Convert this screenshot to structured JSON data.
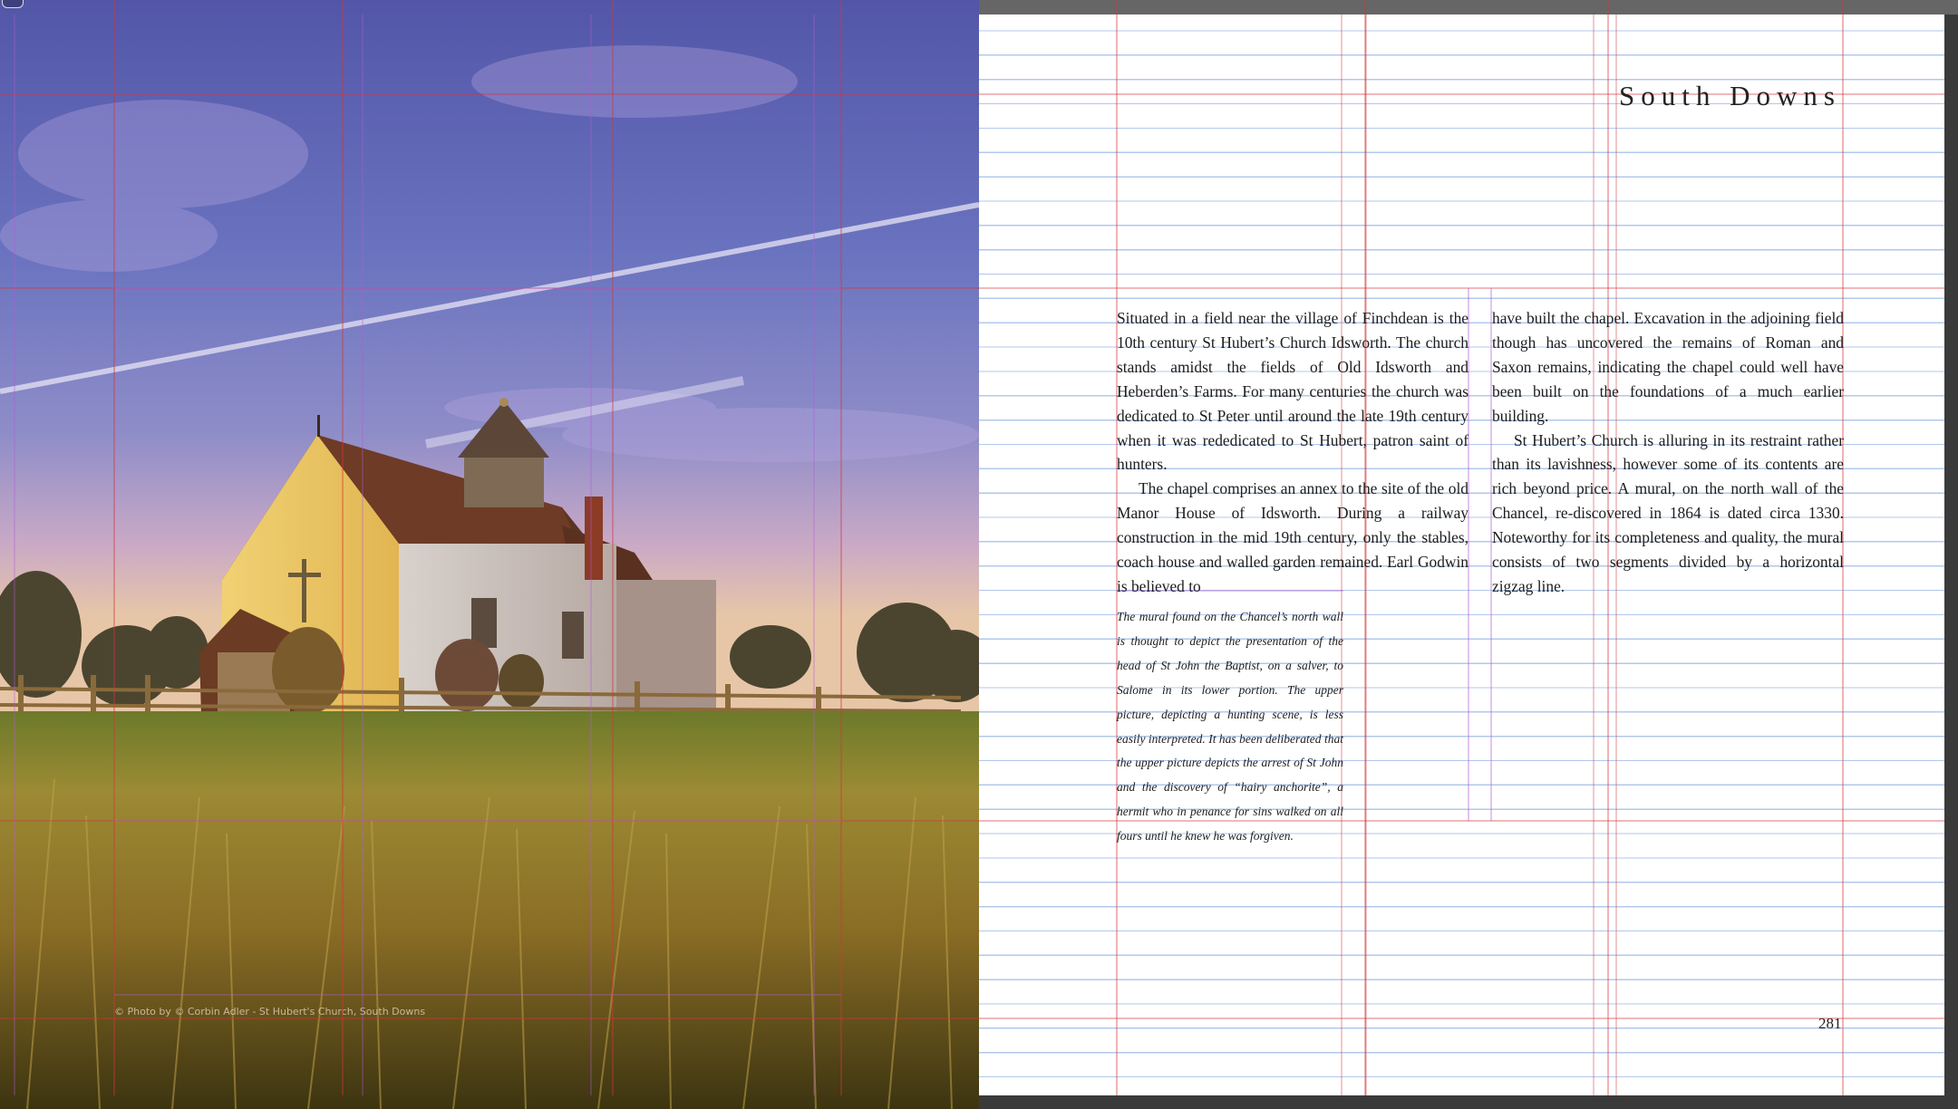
{
  "document": {
    "left_page": {
      "photo_subject": "St Hubert's Church in a grass field at sunset",
      "photo_credit": "© Photo by © Corbin Adler - St Hubert's Church, South Downs"
    },
    "right_page": {
      "heading": "South Downs",
      "column_left": {
        "p1": "Situated in a field near the village of Finchdean is the 10th century St Hubert’s Church Idsworth. The church stands amidst the fields of Old Idsworth and Heberden’s Farms. For many centuries the church was dedicated to St Peter until around the late 19th century when it was rededicated to St Hubert, patron saint of hunters.",
        "p2": "The chapel comprises an annex to the site of the old Manor House of Idsworth. During a railway construction in the mid 19th century, only the stables, coach house and walled garden remained. Earl Godwin is believed to"
      },
      "column_right": {
        "p1": "have built the chapel. Excavation in the adjoining field though has uncovered the remains of Roman and Saxon remains, indicating the chapel could well have been built on the foundations of a much earlier building.",
        "p2": "St Hubert’s Church is alluring in its restraint rather than its lavishness, however some of its contents are rich beyond price. A mural, on the north wall of the Chancel, re-discovered in 1864 is dated circa 1330. Noteworthy for its completeness and quality, the mural consists of two segments divided by a horizontal zigzag line."
      },
      "caption": "The mural found on the Chancel’s north wall is thought to depict the presentation of the head of St John the Baptist, on a salver, to Salome in its lower portion. The upper picture, depicting a hunting scene, is less easily interpreted. It has been deliberated that the upper picture depicts the arrest of St John and the discovery of “hairy anchorite”, a hermit who in penance for sins walked on all fours until he knew he was forgiven.",
      "folio": "281"
    }
  },
  "colors": {
    "baseline_grid": "#a9c4ea",
    "margin_guide": "#d2363a",
    "column_guide": "#b25ad6",
    "sky_top": "#5b5fb2",
    "grass": "#8d7a2c"
  }
}
